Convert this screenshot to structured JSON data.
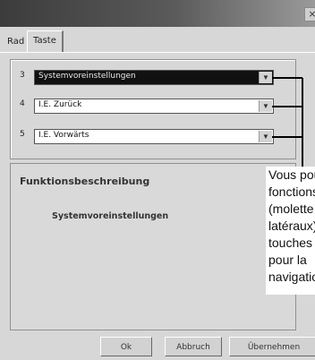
{
  "window": {
    "close_glyph": "×"
  },
  "tabs": [
    {
      "label": "Rad"
    },
    {
      "label": "Taste"
    }
  ],
  "button_rows": [
    {
      "number": "3",
      "value": "Systemvoreinstellungen",
      "selected": true
    },
    {
      "number": "4",
      "value": "I.E. Zurück",
      "selected": false
    },
    {
      "number": "5",
      "value": "I.E. Vorwärts",
      "selected": false
    }
  ],
  "description": {
    "title": "Funktionsbeschreibung",
    "text": "Systemvoreinstellungen"
  },
  "buttons": {
    "ok": "Ok",
    "cancel": "Abbruch",
    "apply": "Übernehmen"
  },
  "callout": {
    "lines": [
      "Vous pouvez affecter des",
      "fonctions aux boutons",
      "(molette et boutons",
      "latéraux) des",
      "touches de la souris",
      "pour la",
      "navigation"
    ]
  },
  "colors": {
    "window_bg": "#d7d7d7",
    "titlebar": "#3c3c3c",
    "selected_field": "#111111"
  }
}
